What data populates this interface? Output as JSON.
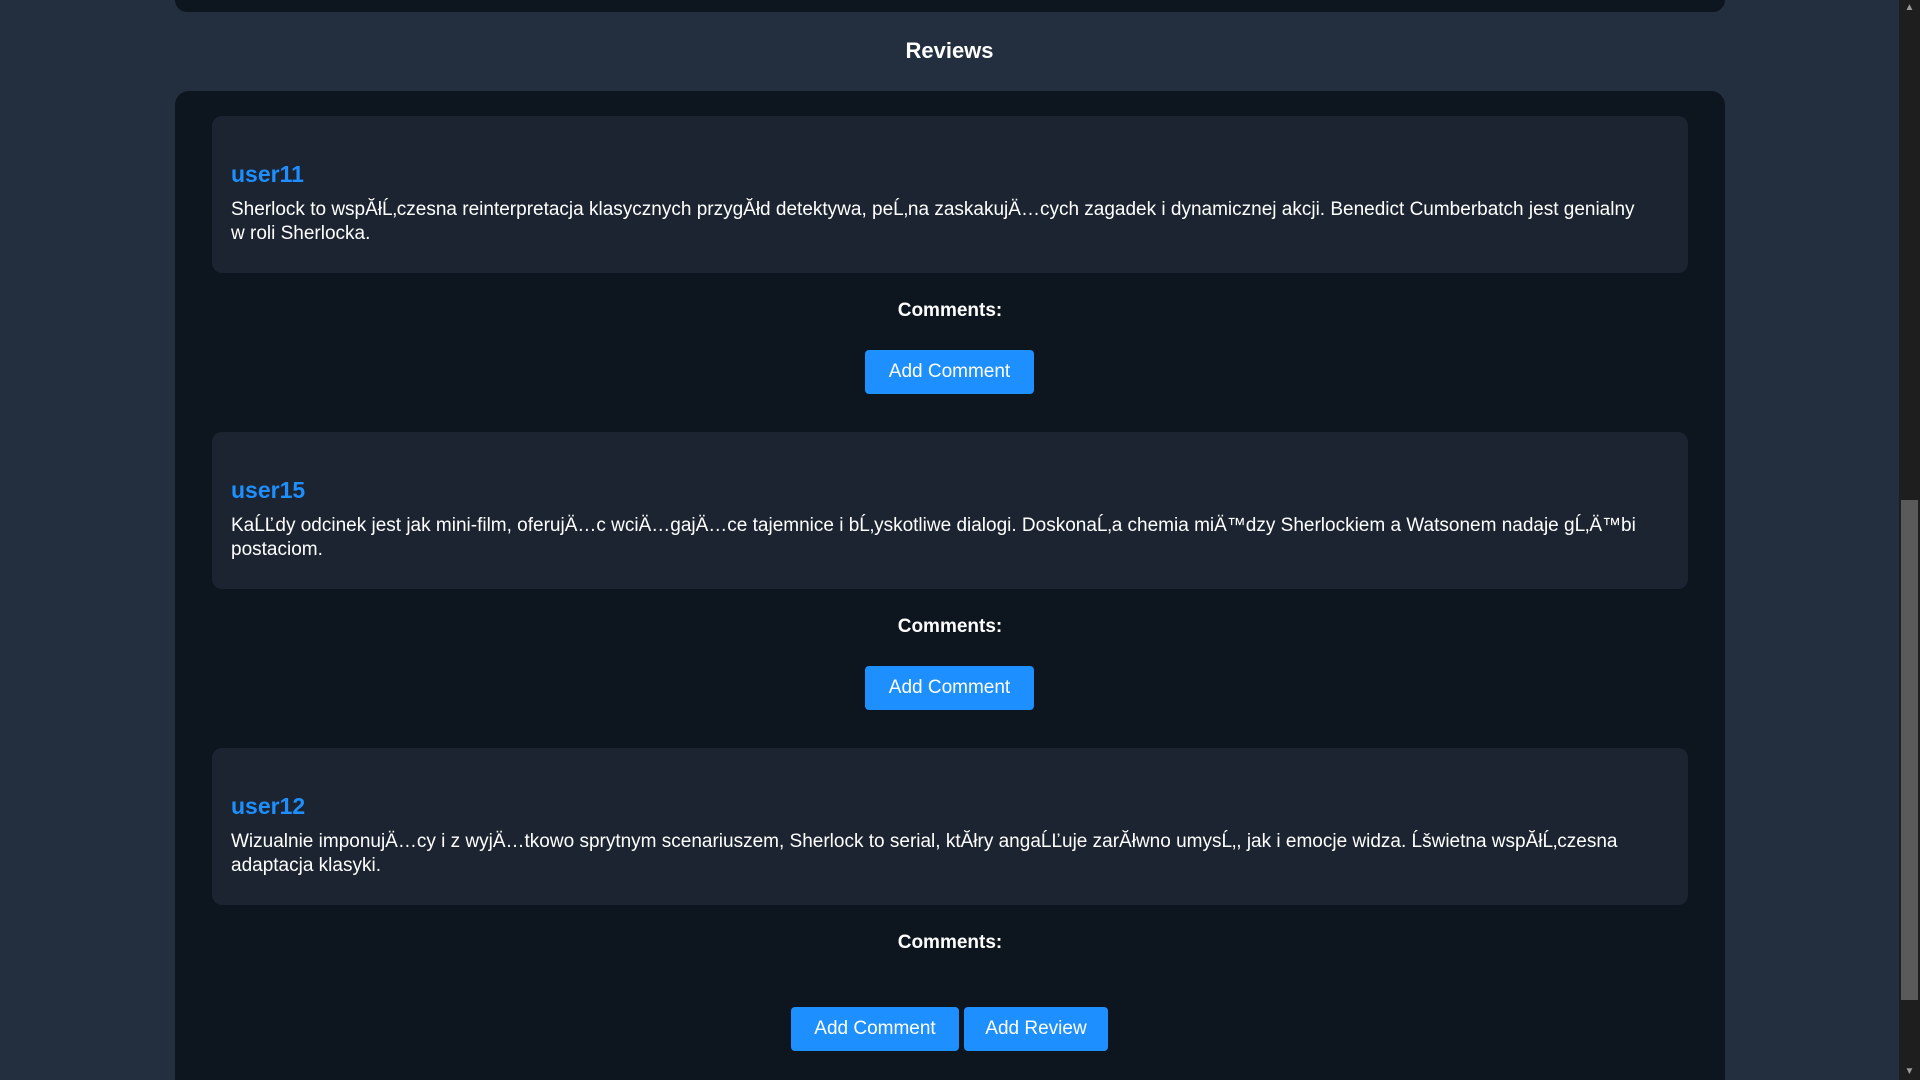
{
  "section": {
    "title": "Reviews"
  },
  "reviews": [
    {
      "user": "user11",
      "text": "Sherlock to wspĂłĹ‚czesna reinterpretacja klasycznych przygĂłd detektywa, peĹ‚na zaskakujÄ…cych zagadek i dynamicznej akcji. Benedict Cumberbatch jest genialny w roli Sherlocka.",
      "comments_label": "Comments:",
      "add_comment_label": "Add Comment"
    },
    {
      "user": "user15",
      "text": "KaĹĽdy odcinek jest jak mini-film, oferujÄ…c wciÄ…gajÄ…ce tajemnice i bĹ‚yskotliwe dialogi. DoskonaĹ‚a chemia miÄ™dzy Sherlockiem a Watsonem nadaje gĹ‚Ä™bi postaciom.",
      "comments_label": "Comments:",
      "add_comment_label": "Add Comment"
    },
    {
      "user": "user12",
      "text": "Wizualnie imponujÄ…cy i z wyjÄ…tkowo sprytnym scenariuszem, Sherlock to serial, ktĂłry angaĹĽuje zarĂłwno umysĹ‚, jak i emocje widza. Ĺšwietna wspĂłĹ‚czesna adaptacja klasyki.",
      "comments_label": "Comments:",
      "add_comment_label": "Add Comment"
    }
  ],
  "actions": {
    "add_review_label": "Add Review"
  },
  "scrollbar": {
    "up_icon": "triangle-up",
    "down_icon": "triangle-down"
  },
  "colors": {
    "page_bg": "#232f3e",
    "container_bg": "#0d151e",
    "card_bg": "#1b2430",
    "accent": "#1e8fff"
  }
}
